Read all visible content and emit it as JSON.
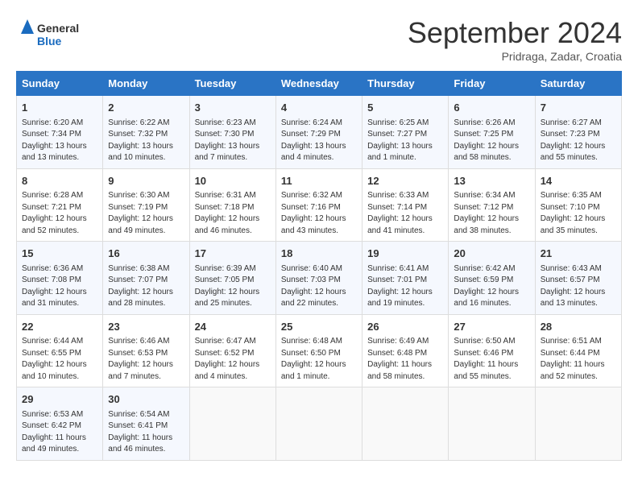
{
  "header": {
    "logo_general": "General",
    "logo_blue": "Blue",
    "month_title": "September 2024",
    "subtitle": "Pridraga, Zadar, Croatia"
  },
  "columns": [
    "Sunday",
    "Monday",
    "Tuesday",
    "Wednesday",
    "Thursday",
    "Friday",
    "Saturday"
  ],
  "weeks": [
    [
      {
        "day": "1",
        "sunrise": "Sunrise: 6:20 AM",
        "sunset": "Sunset: 7:34 PM",
        "daylight": "Daylight: 13 hours and 13 minutes."
      },
      {
        "day": "2",
        "sunrise": "Sunrise: 6:22 AM",
        "sunset": "Sunset: 7:32 PM",
        "daylight": "Daylight: 13 hours and 10 minutes."
      },
      {
        "day": "3",
        "sunrise": "Sunrise: 6:23 AM",
        "sunset": "Sunset: 7:30 PM",
        "daylight": "Daylight: 13 hours and 7 minutes."
      },
      {
        "day": "4",
        "sunrise": "Sunrise: 6:24 AM",
        "sunset": "Sunset: 7:29 PM",
        "daylight": "Daylight: 13 hours and 4 minutes."
      },
      {
        "day": "5",
        "sunrise": "Sunrise: 6:25 AM",
        "sunset": "Sunset: 7:27 PM",
        "daylight": "Daylight: 13 hours and 1 minute."
      },
      {
        "day": "6",
        "sunrise": "Sunrise: 6:26 AM",
        "sunset": "Sunset: 7:25 PM",
        "daylight": "Daylight: 12 hours and 58 minutes."
      },
      {
        "day": "7",
        "sunrise": "Sunrise: 6:27 AM",
        "sunset": "Sunset: 7:23 PM",
        "daylight": "Daylight: 12 hours and 55 minutes."
      }
    ],
    [
      {
        "day": "8",
        "sunrise": "Sunrise: 6:28 AM",
        "sunset": "Sunset: 7:21 PM",
        "daylight": "Daylight: 12 hours and 52 minutes."
      },
      {
        "day": "9",
        "sunrise": "Sunrise: 6:30 AM",
        "sunset": "Sunset: 7:19 PM",
        "daylight": "Daylight: 12 hours and 49 minutes."
      },
      {
        "day": "10",
        "sunrise": "Sunrise: 6:31 AM",
        "sunset": "Sunset: 7:18 PM",
        "daylight": "Daylight: 12 hours and 46 minutes."
      },
      {
        "day": "11",
        "sunrise": "Sunrise: 6:32 AM",
        "sunset": "Sunset: 7:16 PM",
        "daylight": "Daylight: 12 hours and 43 minutes."
      },
      {
        "day": "12",
        "sunrise": "Sunrise: 6:33 AM",
        "sunset": "Sunset: 7:14 PM",
        "daylight": "Daylight: 12 hours and 41 minutes."
      },
      {
        "day": "13",
        "sunrise": "Sunrise: 6:34 AM",
        "sunset": "Sunset: 7:12 PM",
        "daylight": "Daylight: 12 hours and 38 minutes."
      },
      {
        "day": "14",
        "sunrise": "Sunrise: 6:35 AM",
        "sunset": "Sunset: 7:10 PM",
        "daylight": "Daylight: 12 hours and 35 minutes."
      }
    ],
    [
      {
        "day": "15",
        "sunrise": "Sunrise: 6:36 AM",
        "sunset": "Sunset: 7:08 PM",
        "daylight": "Daylight: 12 hours and 31 minutes."
      },
      {
        "day": "16",
        "sunrise": "Sunrise: 6:38 AM",
        "sunset": "Sunset: 7:07 PM",
        "daylight": "Daylight: 12 hours and 28 minutes."
      },
      {
        "day": "17",
        "sunrise": "Sunrise: 6:39 AM",
        "sunset": "Sunset: 7:05 PM",
        "daylight": "Daylight: 12 hours and 25 minutes."
      },
      {
        "day": "18",
        "sunrise": "Sunrise: 6:40 AM",
        "sunset": "Sunset: 7:03 PM",
        "daylight": "Daylight: 12 hours and 22 minutes."
      },
      {
        "day": "19",
        "sunrise": "Sunrise: 6:41 AM",
        "sunset": "Sunset: 7:01 PM",
        "daylight": "Daylight: 12 hours and 19 minutes."
      },
      {
        "day": "20",
        "sunrise": "Sunrise: 6:42 AM",
        "sunset": "Sunset: 6:59 PM",
        "daylight": "Daylight: 12 hours and 16 minutes."
      },
      {
        "day": "21",
        "sunrise": "Sunrise: 6:43 AM",
        "sunset": "Sunset: 6:57 PM",
        "daylight": "Daylight: 12 hours and 13 minutes."
      }
    ],
    [
      {
        "day": "22",
        "sunrise": "Sunrise: 6:44 AM",
        "sunset": "Sunset: 6:55 PM",
        "daylight": "Daylight: 12 hours and 10 minutes."
      },
      {
        "day": "23",
        "sunrise": "Sunrise: 6:46 AM",
        "sunset": "Sunset: 6:53 PM",
        "daylight": "Daylight: 12 hours and 7 minutes."
      },
      {
        "day": "24",
        "sunrise": "Sunrise: 6:47 AM",
        "sunset": "Sunset: 6:52 PM",
        "daylight": "Daylight: 12 hours and 4 minutes."
      },
      {
        "day": "25",
        "sunrise": "Sunrise: 6:48 AM",
        "sunset": "Sunset: 6:50 PM",
        "daylight": "Daylight: 12 hours and 1 minute."
      },
      {
        "day": "26",
        "sunrise": "Sunrise: 6:49 AM",
        "sunset": "Sunset: 6:48 PM",
        "daylight": "Daylight: 11 hours and 58 minutes."
      },
      {
        "day": "27",
        "sunrise": "Sunrise: 6:50 AM",
        "sunset": "Sunset: 6:46 PM",
        "daylight": "Daylight: 11 hours and 55 minutes."
      },
      {
        "day": "28",
        "sunrise": "Sunrise: 6:51 AM",
        "sunset": "Sunset: 6:44 PM",
        "daylight": "Daylight: 11 hours and 52 minutes."
      }
    ],
    [
      {
        "day": "29",
        "sunrise": "Sunrise: 6:53 AM",
        "sunset": "Sunset: 6:42 PM",
        "daylight": "Daylight: 11 hours and 49 minutes."
      },
      {
        "day": "30",
        "sunrise": "Sunrise: 6:54 AM",
        "sunset": "Sunset: 6:41 PM",
        "daylight": "Daylight: 11 hours and 46 minutes."
      },
      null,
      null,
      null,
      null,
      null
    ]
  ]
}
